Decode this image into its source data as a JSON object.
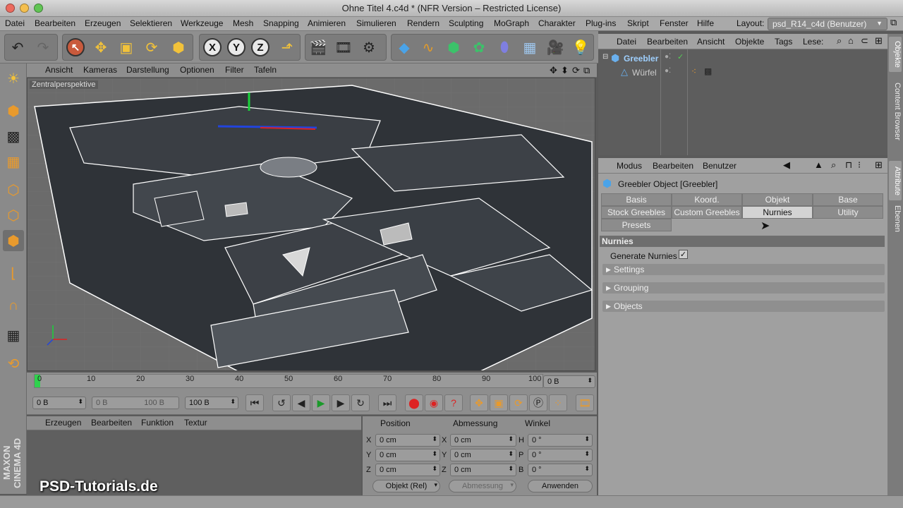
{
  "window": {
    "title": "Ohne Titel 4.c4d * (NFR Version – Restricted License)"
  },
  "menubar": {
    "items": [
      "Datei",
      "Bearbeiten",
      "Erzeugen",
      "Selektieren",
      "Werkzeuge",
      "Mesh",
      "Snapping",
      "Animieren",
      "Simulieren",
      "Rendern",
      "Sculpting",
      "MoGraph",
      "Charakter",
      "Plug-ins",
      "Skript",
      "Fenster",
      "Hilfe"
    ],
    "layout_label": "Layout:",
    "layout_value": "psd_R14_c4d (Benutzer)"
  },
  "toolbar": {
    "icons": [
      "undo-icon",
      "redo-icon",
      "select-icon",
      "move-icon",
      "scale-icon",
      "rotate-icon",
      "recent-tool-icon",
      "x-axis-icon",
      "y-axis-icon",
      "z-axis-icon",
      "coordinate-system-icon",
      "render-view-icon",
      "render-picture-viewer-icon",
      "render-settings-icon",
      "cube-primitive-icon",
      "spline-icon",
      "nurbs-icon",
      "array-icon",
      "deformer-icon",
      "environment-icon",
      "camera-icon",
      "light-icon"
    ],
    "axis_x": "X",
    "axis_y": "Y",
    "axis_z": "Z"
  },
  "viewport": {
    "menu": [
      "Ansicht",
      "Kameras",
      "Darstellung",
      "Optionen",
      "Filter",
      "Tafeln"
    ],
    "label": "Zentralperspektive"
  },
  "timeline": {
    "ticks": [
      "0",
      "10",
      "20",
      "30",
      "40",
      "50",
      "60",
      "70",
      "80",
      "90",
      "100"
    ],
    "current_frame": "0 B",
    "min_field": "0 B",
    "range_start": "0 B",
    "range_end": "100 B",
    "max_field": "100 B"
  },
  "materials": {
    "menu": [
      "Erzeugen",
      "Bearbeiten",
      "Funktion",
      "Textur"
    ]
  },
  "coordinates": {
    "headers": {
      "position": "Position",
      "size": "Abmessung",
      "rotation": "Winkel"
    },
    "rows": [
      {
        "pl": "X",
        "pv": "0 cm",
        "sl": "X",
        "sv": "0 cm",
        "rl": "H",
        "rv": "0 °"
      },
      {
        "pl": "Y",
        "pv": "0 cm",
        "sl": "Y",
        "sv": "0 cm",
        "rl": "P",
        "rv": "0 °"
      },
      {
        "pl": "Z",
        "pv": "0 cm",
        "sl": "Z",
        "sv": "0 cm",
        "rl": "B",
        "rv": "0 °"
      }
    ],
    "mode": "Objekt (Rel)",
    "size_mode": "Abmessung",
    "apply": "Anwenden"
  },
  "objects": {
    "menu": [
      "Datei",
      "Bearbeiten",
      "Ansicht",
      "Objekte",
      "Tags",
      "Lese:"
    ],
    "items": [
      {
        "name": "Greebler"
      },
      {
        "name": "Würfel"
      }
    ]
  },
  "attributes": {
    "menu": [
      "Modus",
      "Bearbeiten",
      "Benutzer"
    ],
    "title": "Greebler Object [Greebler]",
    "tabs_row1": [
      "Basis",
      "Koord.",
      "Objekt",
      "Base"
    ],
    "tabs_row2": [
      "Stock Greebles",
      "Custom Greebles",
      "Nurnies",
      "Utility"
    ],
    "tabs_row3": [
      "Presets"
    ],
    "active_tab": "Nurnies",
    "section_header": "Nurnies",
    "generate_label": "Generate Nurnies",
    "generate_checked": true,
    "groups": [
      "Settings",
      "Grouping",
      "Objects"
    ]
  },
  "side_tabs": [
    "Objekte",
    "Content Browser",
    "Attribute",
    "Ebenen"
  ],
  "brand": {
    "watermark": "PSD-Tutorials.de",
    "logo_text": "MAXON CINEMA 4D"
  },
  "colors": {
    "accent_icon": "#f2c23a",
    "viewport_bg": "#6b6b6b",
    "panel_bg": "#a0a0a0"
  }
}
